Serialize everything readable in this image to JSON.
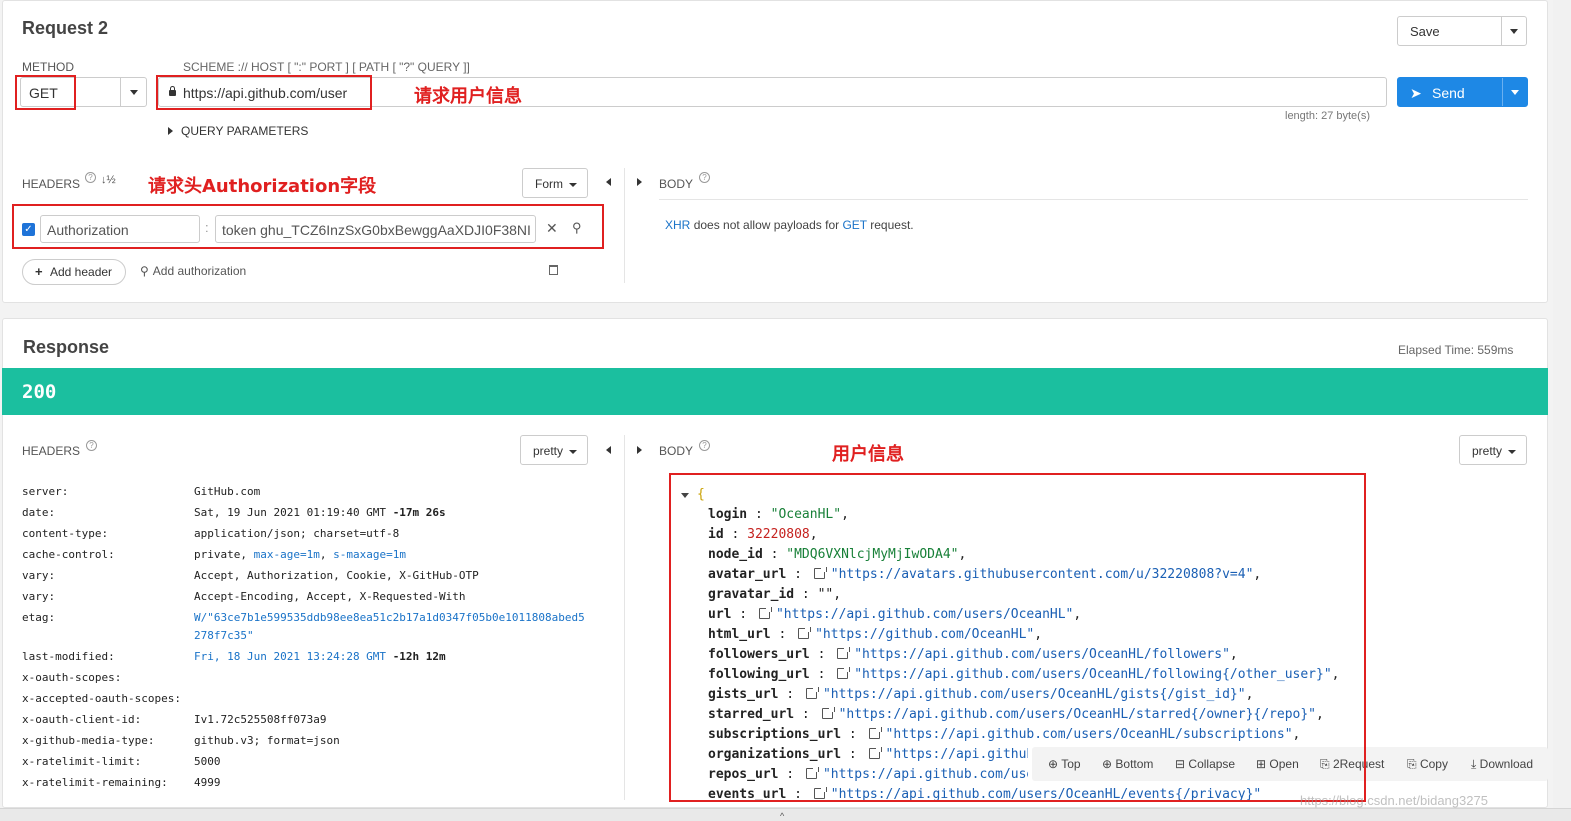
{
  "request": {
    "title": "Request 2",
    "method_label": "METHOD",
    "method": "GET",
    "scheme_hint": "SCHEME :// HOST [ \":\" PORT ] [ PATH [ \"?\" QUERY ]]",
    "url": "https://api.github.com/user",
    "length": "length: 27 byte(s)",
    "query_params": "QUERY PARAMETERS",
    "save": "Save",
    "send": "Send",
    "headers_label": "HEADERS",
    "form": "Form",
    "header_name": "Authorization",
    "header_value": "token ghu_TCZ6InzSxG0bxBewggAaXDJI0F38NI",
    "add_header": "Add header",
    "add_auth": "Add authorization",
    "body_label": "BODY",
    "body_msg_xhr": "XHR",
    "body_msg_mid": "does not allow payloads for",
    "body_msg_get": "GET",
    "body_msg_end": "request."
  },
  "annotations": {
    "url_note": "请求用户信息",
    "header_note": "请求头Authorization字段",
    "body_note": "用户信息"
  },
  "response": {
    "title": "Response",
    "elapsed": "Elapsed Time: 559ms",
    "status": "200",
    "headers_label": "HEADERS",
    "pretty": "pretty",
    "body_label": "BODY",
    "headers": [
      {
        "k": "server:",
        "v": "GitHub.com"
      },
      {
        "k": "date:",
        "v": "Sat, 19 Jun 2021 01:19:40 GMT",
        "extra": "-17m 26s"
      },
      {
        "k": "content-type:",
        "v": "application/json; charset=utf-8"
      },
      {
        "k": "cache-control:",
        "v": "private,",
        "l1": "max-age=1m",
        "l2": "s-maxage=1m"
      },
      {
        "k": "vary:",
        "v": "Accept, Authorization, Cookie, X-GitHub-OTP"
      },
      {
        "k": "vary:",
        "v": "Accept-Encoding, Accept, X-Requested-With"
      },
      {
        "k": "etag:",
        "l1": "W/\"63ce7b1e599535ddb98ee8ea51c2b17a1d0347f05b0e1011808abed5",
        "l2": "278f7c35\""
      },
      {
        "k": "last-modified:",
        "l1": "Fri, 18 Jun 2021 13:24:28 GMT",
        "extra": "-12h 12m"
      },
      {
        "k": "x-oauth-scopes:",
        "v": ""
      },
      {
        "k": "x-accepted-oauth-scopes:",
        "v": ""
      },
      {
        "k": "x-oauth-client-id:",
        "v": "Iv1.72c525508ff073a9"
      },
      {
        "k": "x-github-media-type:",
        "v": "github.v3; format=json"
      },
      {
        "k": "x-ratelimit-limit:",
        "v": "5000"
      },
      {
        "k": "x-ratelimit-remaining:",
        "v": "4999"
      }
    ],
    "body": [
      {
        "k": "login",
        "t": "s",
        "v": "\"OceanHL\""
      },
      {
        "k": "id",
        "t": "n",
        "v": "32220808"
      },
      {
        "k": "node_id",
        "t": "s",
        "v": "\"MDQ6VXNlcjMyMjIwODA4\""
      },
      {
        "k": "avatar_url",
        "t": "u",
        "v": "\"https://avatars.githubusercontent.com/u/32220808?v=4\""
      },
      {
        "k": "gravatar_id",
        "t": "p",
        "v": "\"\""
      },
      {
        "k": "url",
        "t": "u",
        "v": "\"https://api.github.com/users/OceanHL\""
      },
      {
        "k": "html_url",
        "t": "u",
        "v": "\"https://github.com/OceanHL\""
      },
      {
        "k": "followers_url",
        "t": "u",
        "v": "\"https://api.github.com/users/OceanHL/followers\""
      },
      {
        "k": "following_url",
        "t": "u",
        "v": "\"https://api.github.com/users/OceanHL/following{/other_user}\""
      },
      {
        "k": "gists_url",
        "t": "u",
        "v": "\"https://api.github.com/users/OceanHL/gists{/gist_id}\""
      },
      {
        "k": "starred_url",
        "t": "u",
        "v": "\"https://api.github.com/users/OceanHL/starred{/owner}{/repo}\""
      },
      {
        "k": "subscriptions_url",
        "t": "u",
        "v": "\"https://api.github.com/users/OceanHL/subscriptions\""
      },
      {
        "k": "organizations_url",
        "t": "u",
        "v": "\"https://api.github"
      },
      {
        "k": "repos_url",
        "t": "u",
        "v": "\"https://api.github.com/use"
      },
      {
        "k": "events_url",
        "t": "u",
        "v": "\"https://api.github.com/users/OceanHL/events{/privacy}\""
      }
    ],
    "toolbar": {
      "top": "Top",
      "bottom": "Bottom",
      "collapse": "Collapse",
      "open": "Open",
      "request": "2Request",
      "copy": "Copy",
      "download": "Download"
    }
  },
  "watermark": "https://blog.csdn.net/bidang3275",
  "colors": {
    "status_bar": "#1bbf9f",
    "send": "#1e88e5",
    "annotation": "#e02020"
  }
}
